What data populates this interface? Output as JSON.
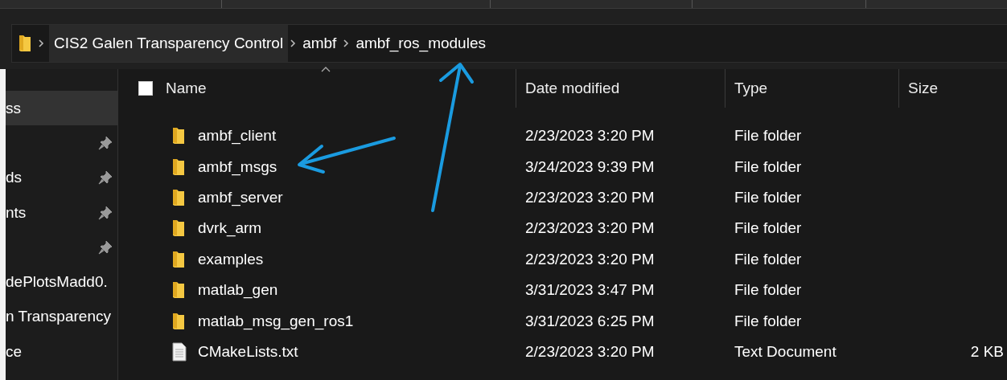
{
  "breadcrumb": [
    {
      "label": "CIS2 Galen Transparency Control",
      "hovered": true
    },
    {
      "label": "ambf",
      "hovered": false
    },
    {
      "label": "ambf_ros_modules",
      "hovered": false
    }
  ],
  "sidebar": {
    "items": [
      {
        "label": "ss",
        "pinned": false,
        "selected": true
      },
      {
        "pinned": true,
        "selected": false
      },
      {
        "label": "ds",
        "pinned": true,
        "selected": false
      },
      {
        "label": "nts",
        "pinned": true,
        "selected": false
      },
      {
        "pinned": true,
        "selected": false
      },
      {
        "label": "dePlotsMadd0.",
        "pinned": false,
        "selected": false
      },
      {
        "label": "n Transparency",
        "pinned": false,
        "selected": false
      },
      {
        "label": "ce",
        "pinned": false,
        "selected": false
      }
    ]
  },
  "table": {
    "select_all": {
      "checked": false
    },
    "columns": [
      "Name",
      "Date modified",
      "Type",
      "Size"
    ],
    "rows": [
      {
        "kind": "folder",
        "name": "ambf_client",
        "date": "2/23/2023 3:20 PM",
        "type": "File folder"
      },
      {
        "kind": "folder",
        "name": "ambf_msgs",
        "date": "3/24/2023 9:39 PM",
        "type": "File folder"
      },
      {
        "kind": "folder",
        "name": "ambf_server",
        "date": "2/23/2023 3:20 PM",
        "type": "File folder"
      },
      {
        "kind": "folder",
        "name": "dvrk_arm",
        "date": "2/23/2023 3:20 PM",
        "type": "File folder"
      },
      {
        "kind": "folder",
        "name": "examples",
        "date": "2/23/2023 3:20 PM",
        "type": "File folder"
      },
      {
        "kind": "folder",
        "name": "matlab_gen",
        "date": "3/31/2023 3:47 PM",
        "type": "File folder"
      },
      {
        "kind": "folder",
        "name": "matlab_msg_gen_ros1",
        "date": "3/31/2023 6:25 PM",
        "type": "File folder"
      },
      {
        "kind": "text",
        "name": "CMakeLists.txt",
        "date": "2/23/2023 3:20 PM",
        "type": "Text Document",
        "size": "2 KB"
      }
    ]
  }
}
